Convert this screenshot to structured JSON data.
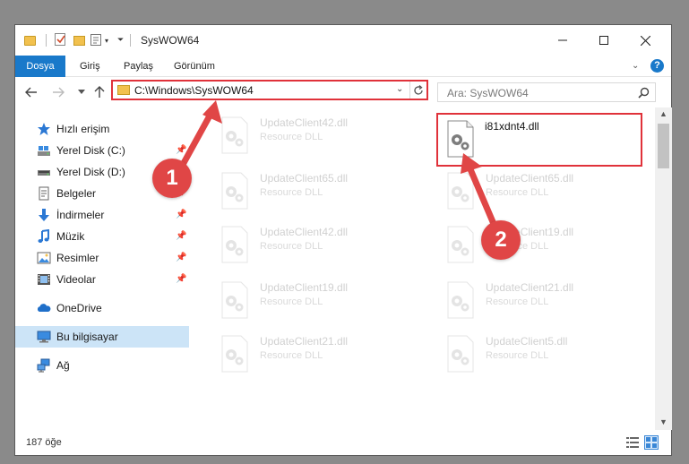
{
  "window": {
    "title": "SysWOW64"
  },
  "ribbon": {
    "tabs": [
      {
        "label": "Dosya",
        "active": true
      },
      {
        "label": "Giriş"
      },
      {
        "label": "Paylaş"
      },
      {
        "label": "Görünüm"
      }
    ],
    "help_label": "?"
  },
  "nav": {
    "address": "C:\\Windows\\SysWOW64",
    "search_placeholder": "Ara: SysWOW64"
  },
  "sidebar": {
    "items": [
      {
        "label": "Hızlı erişim",
        "icon": "star-icon",
        "pinned": false
      },
      {
        "label": "Yerel Disk (C:)",
        "icon": "drive-icon",
        "pinned": true
      },
      {
        "label": "Yerel Disk (D:)",
        "icon": "drive-icon",
        "pinned": true
      },
      {
        "label": "Belgeler",
        "icon": "documents-icon",
        "pinned": true
      },
      {
        "label": "İndirmeler",
        "icon": "download-icon",
        "pinned": true
      },
      {
        "label": "Müzik",
        "icon": "music-icon",
        "pinned": true
      },
      {
        "label": "Resimler",
        "icon": "pictures-icon",
        "pinned": true
      },
      {
        "label": "Videolar",
        "icon": "videos-icon",
        "pinned": true
      },
      {
        "label": "OneDrive",
        "icon": "cloud-icon",
        "pinned": false
      },
      {
        "label": "Bu bilgisayar",
        "icon": "computer-icon",
        "pinned": false,
        "selected": true
      },
      {
        "label": "Ağ",
        "icon": "network-icon",
        "pinned": false
      }
    ]
  },
  "files": {
    "left_column": [
      {
        "name": "UpdateClient42.dll",
        "type": "Resource DLL"
      },
      {
        "name": "UpdateClient65.dll",
        "type": "Resource DLL"
      },
      {
        "name": "UpdateClient42.dll",
        "type": "Resource DLL"
      },
      {
        "name": "UpdateClient19.dll",
        "type": "Resource DLL"
      },
      {
        "name": "UpdateClient21.dll",
        "type": "Resource DLL"
      }
    ],
    "right_column": [
      {
        "name": "i81xdnt4.dll",
        "type": "",
        "highlighted": true
      },
      {
        "name": "UpdateClient65.dll",
        "type": "Resource DLL"
      },
      {
        "name": "UpdateClient19.dll",
        "type": "Resource DLL"
      },
      {
        "name": "UpdateClient21.dll",
        "type": "Resource DLL"
      },
      {
        "name": "UpdateClient5.dll",
        "type": "Resource DLL"
      }
    ]
  },
  "status": {
    "item_count": "187 öğe"
  },
  "callouts": [
    {
      "number": "1"
    },
    {
      "number": "2"
    }
  ],
  "colors": {
    "accent": "#1979ca",
    "callout_red": "#e04646",
    "highlight_border": "#e0323a",
    "selection": "#cce4f7"
  }
}
